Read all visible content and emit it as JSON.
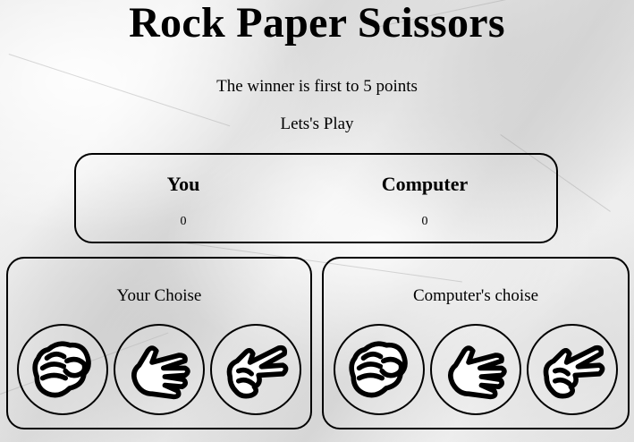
{
  "game": {
    "title": "Rock Paper Scissors",
    "rule": "The winner is first to 5 points",
    "prompt": "Lets's Play"
  },
  "scoreboard": {
    "player_label": "You",
    "player_score": "0",
    "computer_label": "Computer",
    "computer_score": "0"
  },
  "player_panel": {
    "label": "Your Choise",
    "choices": [
      "rock-hand-icon",
      "paper-hand-icon",
      "scissors-hand-icon"
    ]
  },
  "computer_panel": {
    "label": "Computer's choise",
    "choices": [
      "rock-hand-icon",
      "paper-hand-icon",
      "scissors-hand-icon"
    ]
  }
}
